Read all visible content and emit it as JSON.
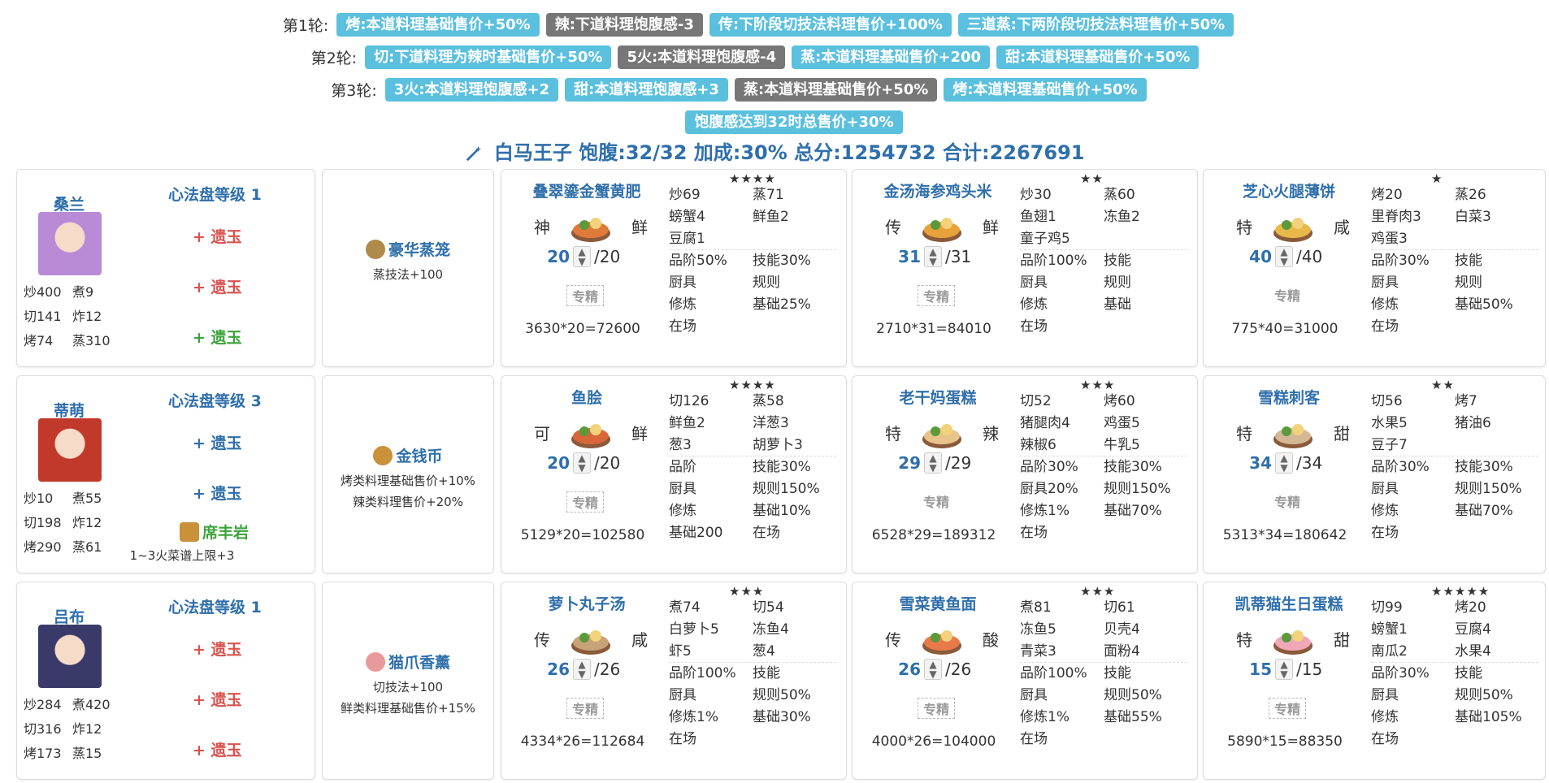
{
  "rounds": [
    {
      "label": "第1轮:",
      "tags": [
        {
          "text": "烤:本道料理基础售价+50%",
          "color": "blue"
        },
        {
          "text": "辣:下道料理饱腹感-3",
          "color": "gray"
        },
        {
          "text": "传:下阶段切技法料理售价+100%",
          "color": "blue"
        },
        {
          "text": "三道蒸:下两阶段切技法料理售价+50%",
          "color": "blue"
        }
      ]
    },
    {
      "label": "第2轮:",
      "tags": [
        {
          "text": "切:下道料理为辣时基础售价+50%",
          "color": "blue"
        },
        {
          "text": "5火:本道料理饱腹感-4",
          "color": "gray"
        },
        {
          "text": "蒸:本道料理基础售价+200",
          "color": "blue"
        },
        {
          "text": "甜:本道料理基础售价+50%",
          "color": "blue"
        }
      ]
    },
    {
      "label": "第3轮:",
      "tags": [
        {
          "text": "3火:本道料理饱腹感+2",
          "color": "blue"
        },
        {
          "text": "甜:本道料理饱腹感+3",
          "color": "blue"
        },
        {
          "text": "蒸:本道料理基础售价+50%",
          "color": "gray"
        },
        {
          "text": "烤:本道料理基础售价+50%",
          "color": "blue"
        }
      ]
    },
    {
      "label": "",
      "tags": [
        {
          "text": "饱腹感达到32时总售价+30%",
          "color": "blue"
        }
      ]
    }
  ],
  "summary": "白马王子 饱腹:32/32 加成:30% 总分:1254732 合计:2267691",
  "rows": [
    {
      "chef": {
        "name": "桑兰",
        "xinfa": "心法盘等级 1",
        "stats": [
          [
            "炒400",
            "煮9"
          ],
          [
            "切141",
            "炸12"
          ],
          [
            "烤74",
            "蒸310"
          ]
        ],
        "yuyu": [
          {
            "text": "+ 遗玉",
            "color": "red"
          },
          {
            "text": "+ 遗玉",
            "color": "red"
          },
          {
            "text": "+ 遗玉",
            "color": "green"
          }
        ],
        "relic": null,
        "relic_desc": "",
        "avatar_color": "#b98ad6"
      },
      "equip": {
        "name": "豪华蒸笼",
        "desc": [
          "蒸技法+100"
        ],
        "icon_color": "#b08a4a"
      },
      "dishes": [
        {
          "name": "叠翠鎏金蟹黄肥",
          "left": "神",
          "right": "鲜",
          "qty": "20",
          "max": "/20",
          "zj": "专精",
          "formula": "3630*20=72600",
          "stars": "★★★★",
          "grid": [
            [
              "炒69",
              "蒸71"
            ],
            [
              "螃蟹4",
              "鲜鱼2"
            ],
            [
              "豆腐1",
              ""
            ],
            [
              "品阶50%",
              "技能30%"
            ],
            [
              "厨具",
              "规则"
            ],
            [
              "修炼",
              "基础25%"
            ],
            [
              "在场",
              ""
            ]
          ],
          "dash": [
            2
          ],
          "img": "#e07a3a"
        },
        {
          "name": "金汤海参鸡头米",
          "left": "传",
          "right": "鲜",
          "qty": "31",
          "max": "/31",
          "zj": "专精",
          "formula": "2710*31=84010",
          "stars": "★★",
          "grid": [
            [
              "炒30",
              "蒸60"
            ],
            [
              "鱼翅1",
              "冻鱼2"
            ],
            [
              "童子鸡5",
              ""
            ],
            [
              "品阶100%",
              "技能"
            ],
            [
              "厨具",
              "规则"
            ],
            [
              "修炼",
              "基础"
            ],
            [
              "在场",
              ""
            ]
          ],
          "dash": [
            2
          ],
          "img": "#e8a23a"
        },
        {
          "name": "芝心火腿薄饼",
          "left": "特",
          "right": "咸",
          "qty": "40",
          "max": "/40",
          "zj": "专精",
          "formula": "775*40=31000",
          "stars": "★",
          "grid": [
            [
              "烤20",
              "蒸26"
            ],
            [
              "里脊肉3",
              "白菜3"
            ],
            [
              "鸡蛋3",
              ""
            ],
            [
              "品阶30%",
              "技能"
            ],
            [
              "厨具",
              "规则"
            ],
            [
              "修炼",
              "基础50%"
            ],
            [
              "在场",
              ""
            ]
          ],
          "dash": [
            2
          ],
          "img": "#e8b84a",
          "plain": true
        }
      ]
    },
    {
      "chef": {
        "name": "蒂萌",
        "xinfa": "心法盘等级 3",
        "stats": [
          [
            "炒10",
            "煮55"
          ],
          [
            "切198",
            "炸12"
          ],
          [
            "烤290",
            "蒸61"
          ]
        ],
        "yuyu": [
          {
            "text": "+ 遗玉",
            "color": "blue"
          },
          {
            "text": "+ 遗玉",
            "color": "blue"
          }
        ],
        "relic": "席丰岩",
        "relic_desc": "1~3火菜谱上限+3",
        "avatar_color": "#c0392b"
      },
      "equip": {
        "name": "金钱币",
        "desc": [
          "烤类料理基础售价+10%",
          "辣类料理售价+20%"
        ],
        "icon_color": "#c8913a"
      },
      "dishes": [
        {
          "name": "鱼脍",
          "left": "可",
          "right": "鲜",
          "qty": "20",
          "max": "/20",
          "zj": "专精",
          "formula": "5129*20=102580",
          "stars": "★★★★",
          "grid": [
            [
              "切126",
              "蒸58"
            ],
            [
              "鲜鱼2",
              "洋葱3"
            ],
            [
              "葱3",
              "胡萝卜3"
            ],
            [
              "品阶",
              "技能30%"
            ],
            [
              "厨具",
              "规则150%"
            ],
            [
              "修炼",
              "基础10%"
            ],
            [
              "基础200",
              "在场"
            ]
          ],
          "dash": [
            2
          ],
          "img": "#d8663a"
        },
        {
          "name": "老干妈蛋糕",
          "left": "特",
          "right": "辣",
          "qty": "29",
          "max": "/29",
          "zj": "专精",
          "formula": "6528*29=189312",
          "stars": "★★★",
          "grid": [
            [
              "切52",
              "烤60"
            ],
            [
              "猪腿肉4",
              "鸡蛋5"
            ],
            [
              "辣椒6",
              "牛乳5"
            ],
            [
              "品阶30%",
              "技能30%"
            ],
            [
              "厨具20%",
              "规则150%"
            ],
            [
              "修炼1%",
              "基础70%"
            ],
            [
              "在场",
              ""
            ]
          ],
          "dash": [
            2
          ],
          "img": "#e8c48a",
          "plain": true
        },
        {
          "name": "雪糕刺客",
          "left": "特",
          "right": "甜",
          "qty": "34",
          "max": "/34",
          "zj": "专精",
          "formula": "5313*34=180642",
          "stars": "★★",
          "grid": [
            [
              "切56",
              "烤7"
            ],
            [
              "水果5",
              "猪油6"
            ],
            [
              "豆子7",
              ""
            ],
            [
              "品阶30%",
              "技能30%"
            ],
            [
              "厨具",
              "规则150%"
            ],
            [
              "修炼",
              "基础70%"
            ],
            [
              "在场",
              ""
            ]
          ],
          "dash": [
            2
          ],
          "img": "#d4b896",
          "plain": true
        }
      ]
    },
    {
      "chef": {
        "name": "吕布",
        "xinfa": "心法盘等级 1",
        "stats": [
          [
            "炒284",
            "煮420"
          ],
          [
            "切316",
            "炸12"
          ],
          [
            "烤173",
            "蒸15"
          ]
        ],
        "yuyu": [
          {
            "text": "+ 遗玉",
            "color": "red"
          },
          {
            "text": "+ 遗玉",
            "color": "red"
          },
          {
            "text": "+ 遗玉",
            "color": "red"
          }
        ],
        "relic": null,
        "relic_desc": "",
        "avatar_color": "#3a3a6a"
      },
      "equip": {
        "name": "猫爪香薰",
        "desc": [
          "切技法+100",
          "鲜类料理基础售价+15%"
        ],
        "icon_color": "#e89a9a"
      },
      "dishes": [
        {
          "name": "萝卜丸子汤",
          "left": "传",
          "right": "咸",
          "qty": "26",
          "max": "/26",
          "zj": "专精",
          "formula": "4334*26=112684",
          "stars": "★★★",
          "grid": [
            [
              "煮74",
              "切54"
            ],
            [
              "白萝卜5",
              "冻鱼4"
            ],
            [
              "虾5",
              "葱4"
            ],
            [
              "品阶100%",
              "技能"
            ],
            [
              "厨具",
              "规则50%"
            ],
            [
              "修炼1%",
              "基础30%"
            ],
            [
              "在场",
              ""
            ]
          ],
          "dash": [
            2
          ],
          "img": "#c8a278"
        },
        {
          "name": "雪菜黄鱼面",
          "left": "传",
          "right": "酸",
          "qty": "26",
          "max": "/26",
          "zj": "专精",
          "formula": "4000*26=104000",
          "stars": "★★★",
          "grid": [
            [
              "煮81",
              "切61"
            ],
            [
              "冻鱼5",
              "贝壳4"
            ],
            [
              "青菜3",
              "面粉4"
            ],
            [
              "品阶100%",
              "技能"
            ],
            [
              "厨具",
              "规则50%"
            ],
            [
              "修炼1%",
              "基础55%"
            ],
            [
              "在场",
              ""
            ]
          ],
          "dash": [
            2
          ],
          "img": "#e87a4a"
        },
        {
          "name": "凯蒂猫生日蛋糕",
          "left": "特",
          "right": "甜",
          "qty": "15",
          "max": "/15",
          "zj": "专精",
          "formula": "5890*15=88350",
          "stars": "★★★★★",
          "grid": [
            [
              "切99",
              "烤20"
            ],
            [
              "螃蟹1",
              "豆腐4"
            ],
            [
              "南瓜2",
              "水果4"
            ],
            [
              "品阶30%",
              "技能"
            ],
            [
              "厨具",
              "规则50%"
            ],
            [
              "修炼",
              "基础105%"
            ],
            [
              "在场",
              ""
            ]
          ],
          "dash": [
            2
          ],
          "img": "#f0a8b8"
        }
      ]
    }
  ]
}
